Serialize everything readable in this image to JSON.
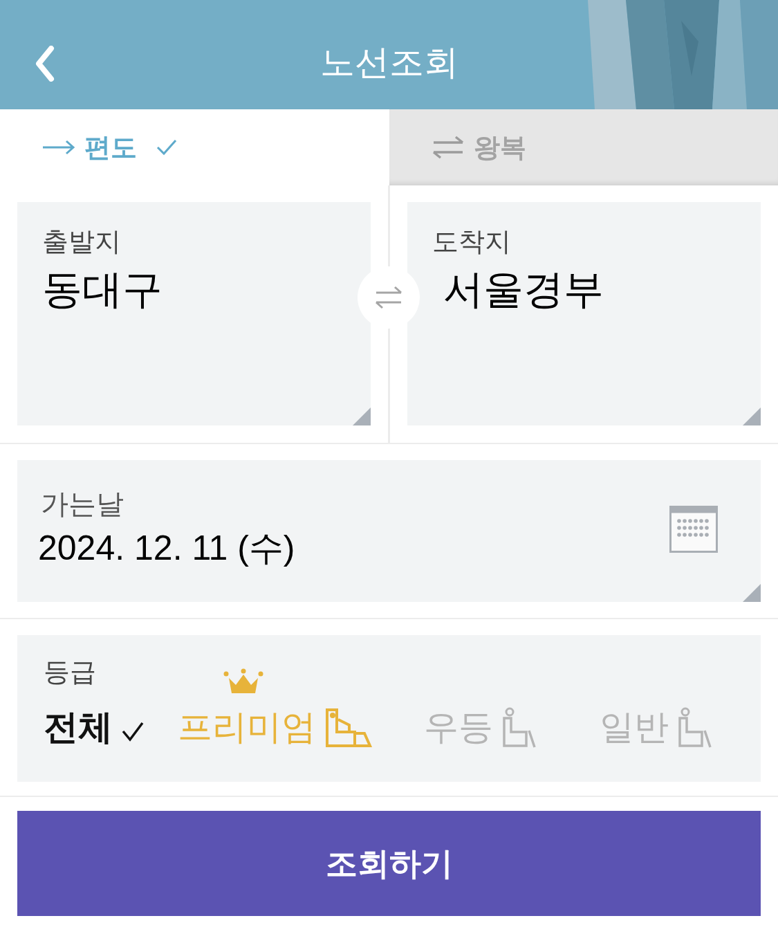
{
  "header": {
    "title": "노선조회"
  },
  "trip_tabs": [
    {
      "label": "편도",
      "kind": "oneway",
      "selected": true
    },
    {
      "label": "왕복",
      "kind": "roundtrip",
      "selected": false
    }
  ],
  "departure": {
    "label": "출발지",
    "value": "동대구"
  },
  "arrival": {
    "label": "도착지",
    "value": "서울경부"
  },
  "date": {
    "label": "가는날",
    "value": "2024. 12. 11 (수)"
  },
  "grade": {
    "label": "등급",
    "options": [
      {
        "label": "전체",
        "kind": "all",
        "selected": true
      },
      {
        "label": "프리미엄",
        "kind": "premium",
        "selected": false
      },
      {
        "label": "우등",
        "kind": "deluxe",
        "selected": false
      },
      {
        "label": "일반",
        "kind": "standard",
        "selected": false
      }
    ]
  },
  "search_button": {
    "label": "조회하기"
  }
}
